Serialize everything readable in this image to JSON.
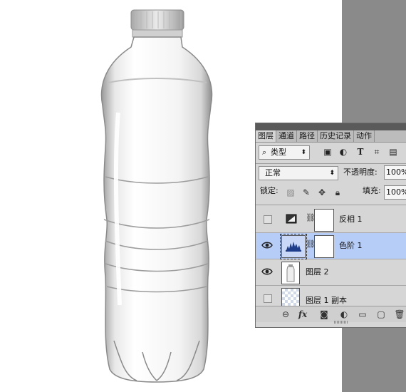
{
  "panel": {
    "tabs": [
      "图层",
      "通道",
      "路径",
      "历史记录",
      "动作"
    ],
    "filter_label": "类型",
    "blend_mode": "正常",
    "opacity_label": "不透明度:",
    "opacity_value": "100%",
    "lock_label": "锁定:",
    "fill_label": "填充:",
    "fill_value": "100%",
    "layers": [
      {
        "name": "反相 1",
        "visible": false,
        "selected": false
      },
      {
        "name": "色阶 1",
        "visible": true,
        "selected": true
      },
      {
        "name": "图层 2",
        "visible": true,
        "selected": false
      },
      {
        "name": "图层 1 副本",
        "visible": false,
        "selected": false
      }
    ],
    "fx_label": "fx"
  },
  "colors": {
    "panel_bg": "#d6d6d6",
    "selected_layer": "#b6cdf7",
    "side_gray": "#8a8a8a"
  }
}
